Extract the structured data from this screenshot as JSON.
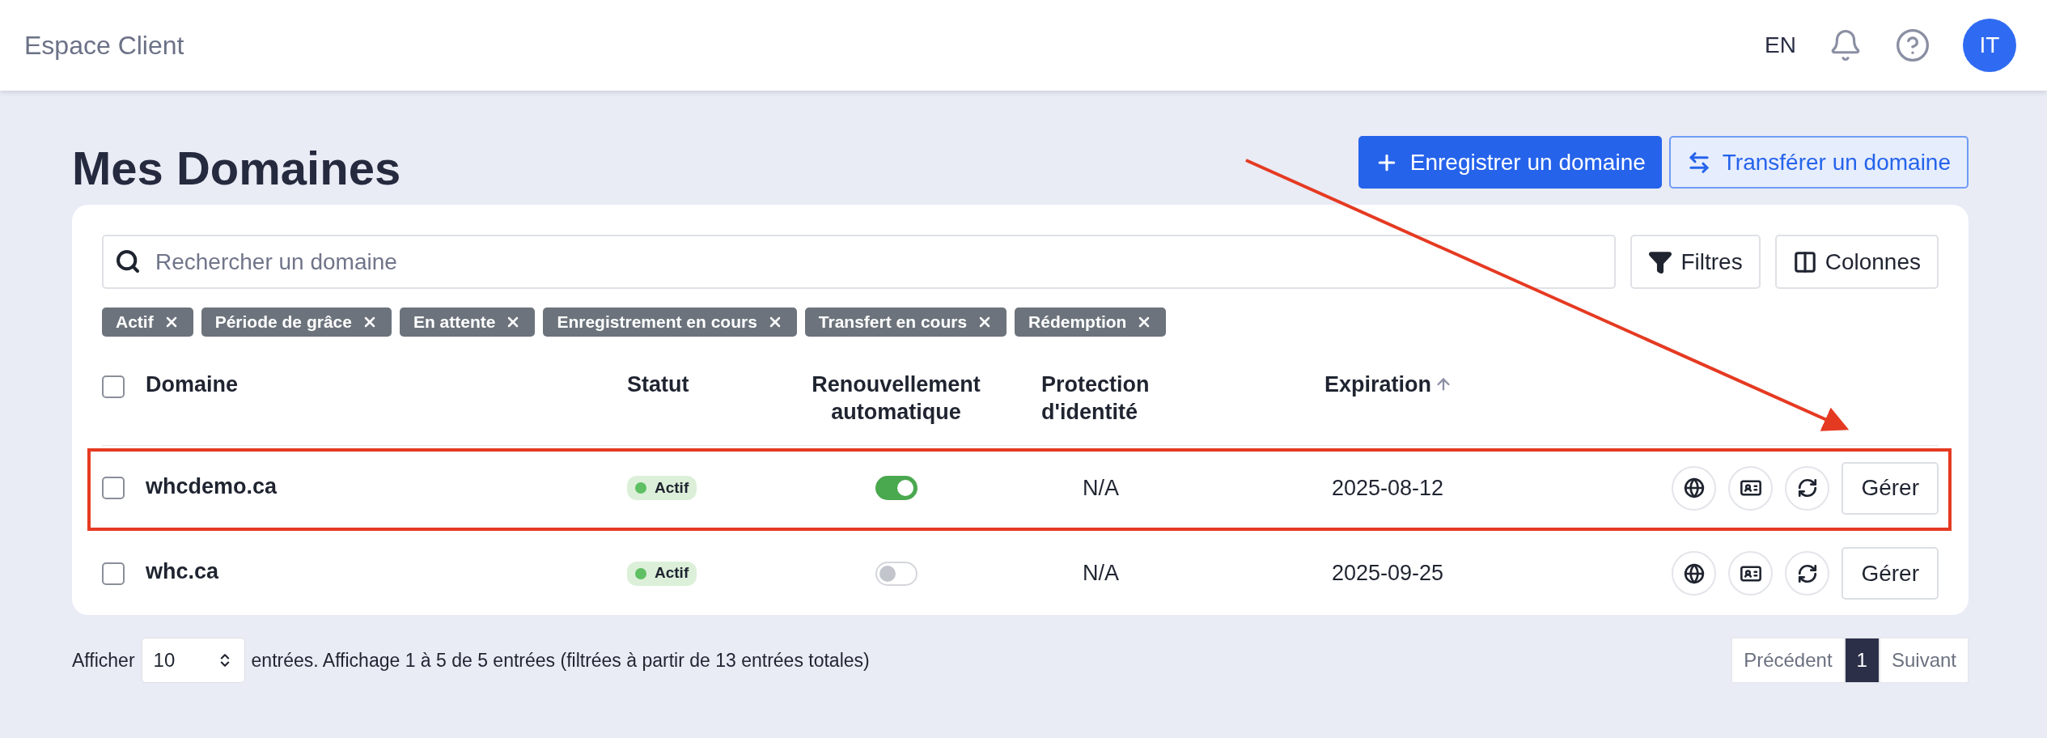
{
  "header": {
    "brand": "Espace Client",
    "language": "EN",
    "avatar": "IT"
  },
  "page": {
    "title": "Mes Domaines",
    "actions": [
      {
        "kind": "register",
        "label": "Enregistrer un domaine"
      },
      {
        "kind": "transfer",
        "label": "Transférer un domaine"
      }
    ]
  },
  "search": {
    "placeholder": "Rechercher un domaine"
  },
  "tools": [
    {
      "kind": "filter",
      "label": "Filtres"
    },
    {
      "kind": "columns",
      "label": "Colonnes"
    }
  ],
  "filter_chips": [
    "Actif",
    "Période de grâce",
    "En attente",
    "Enregistrement en cours",
    "Transfert en cours",
    "Rédemption"
  ],
  "table": {
    "select_all_checked": false,
    "columns": [
      {
        "label": "Domaine",
        "sorted": false
      },
      {
        "label": "Statut",
        "sorted": false
      },
      {
        "label": "Renouvellement automatique",
        "sorted": false
      },
      {
        "label": "Protection d'identité",
        "sorted": false
      },
      {
        "label": "Expiration",
        "sorted": true
      }
    ],
    "rows": [
      {
        "checked": false,
        "domain": "whcdemo.ca",
        "status": "Actif",
        "auto_renew": true,
        "identity_protection": "N/A",
        "expiration": "2025-08-12",
        "action": "Gérer"
      },
      {
        "checked": false,
        "domain": "whc.ca",
        "status": "Actif",
        "auto_renew": false,
        "identity_protection": "N/A",
        "expiration": "2025-09-25",
        "action": "Gérer"
      }
    ]
  },
  "footer": {
    "show_label": "Afficher",
    "page_size": "10",
    "summary": "entrées. Affichage 1 à 5 de 5 entrées (filtrées à partir de 13 entrées totales)",
    "pagination": [
      {
        "label": "Précédent",
        "selected": false
      },
      {
        "label": "1",
        "selected": true
      },
      {
        "label": "Suivant",
        "selected": false
      }
    ]
  }
}
